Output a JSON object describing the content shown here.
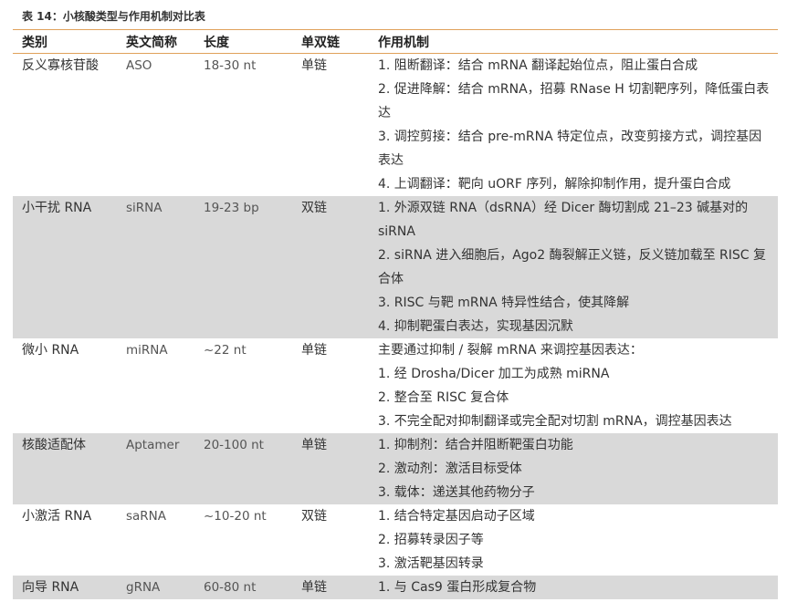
{
  "caption": "表 14：小核酸类型与作用机制对比表",
  "headers": [
    "类别",
    "英文简称",
    "长度",
    "单双链",
    "作用机制"
  ],
  "rows": [
    {
      "category": "反义寡核苷酸",
      "abbr": "ASO",
      "length": "18-30 nt",
      "strand": "单链",
      "mechanisms": [
        "1. 阻断翻译：结合 mRNA 翻译起始位点，阻止蛋白合成",
        "2. 促进降解：结合 mRNA，招募 RNase H 切割靶序列，降低蛋白表达",
        "3. 调控剪接：结合 pre-mRNA 特定位点，改变剪接方式，调控基因表达",
        "4. 上调翻译：靶向 uORF 序列，解除抑制作用，提升蛋白合成"
      ],
      "shaded": false
    },
    {
      "category": "小干扰 RNA",
      "abbr": "siRNA",
      "length": "19-23 bp",
      "strand": "双链",
      "mechanisms": [
        "1. 外源双链 RNA（dsRNA）经 Dicer 酶切割成 21–23 碱基对的 siRNA",
        "2. siRNA 进入细胞后，Ago2 酶裂解正义链，反义链加载至 RISC 复合体",
        "3. RISC 与靶 mRNA 特异性结合，使其降解",
        "4. 抑制靶蛋白表达，实现基因沉默"
      ],
      "shaded": true
    },
    {
      "category": "微小 RNA",
      "abbr": "miRNA",
      "length": "~22 nt",
      "strand": "单链",
      "mechanisms": [
        "主要通过抑制 / 裂解 mRNA 来调控基因表达：",
        "1. 经 Drosha/Dicer 加工为成熟 miRNA",
        "2. 整合至 RISC 复合体",
        "3. 不完全配对抑制翻译或完全配对切割 mRNA，调控基因表达"
      ],
      "shaded": false
    },
    {
      "category": "核酸适配体",
      "abbr": "Aptamer",
      "length": "20-100 nt",
      "strand": "单链",
      "mechanisms": [
        "1. 抑制剂：结合并阻断靶蛋白功能",
        "2. 激动剂：激活目标受体",
        "3. 载体：递送其他药物分子"
      ],
      "shaded": true
    },
    {
      "category": "小激活 RNA",
      "abbr": "saRNA",
      "length": "~10-20 nt",
      "strand": "双链",
      "mechanisms": [
        "1. 结合特定基因启动子区域",
        "2. 招募转录因子等",
        "3. 激活靶基因转录"
      ],
      "shaded": false
    },
    {
      "category": "向导 RNA",
      "abbr": "gRNA",
      "length": "60-80 nt",
      "strand": "单链",
      "mechanisms": [
        "1. 与 Cas9 蛋白形成复合物"
      ],
      "shaded": true
    }
  ]
}
